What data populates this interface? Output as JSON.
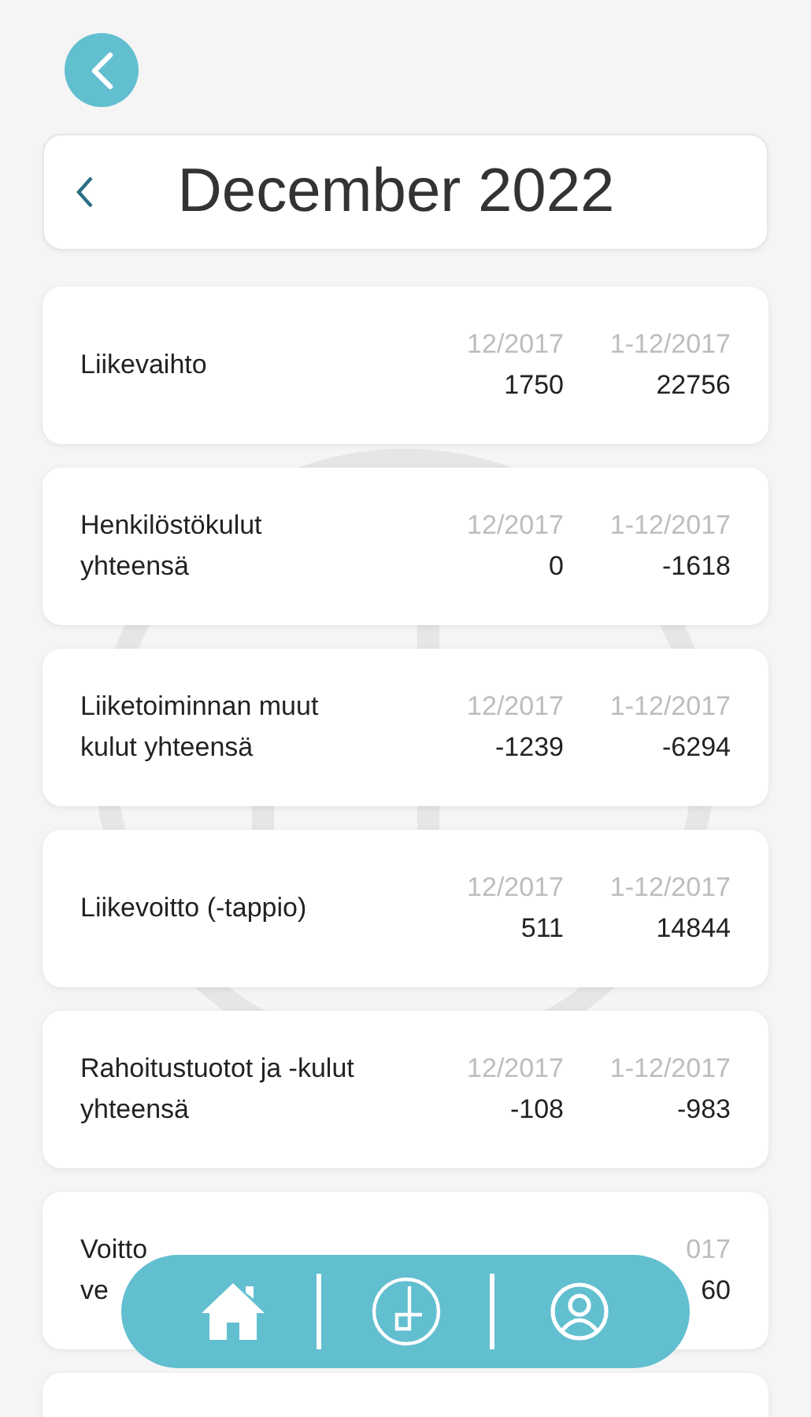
{
  "header": {
    "title": "December 2022"
  },
  "rows": [
    {
      "label": "Liikevaihto",
      "columns": [
        {
          "period": "12/2017",
          "value": "1750"
        },
        {
          "period": "1-12/2017",
          "value": "22756"
        }
      ]
    },
    {
      "label": "Henkilöstökulut yhteensä",
      "columns": [
        {
          "period": "12/2017",
          "value": "0"
        },
        {
          "period": "1-12/2017",
          "value": "-1618"
        }
      ]
    },
    {
      "label": "Liiketoiminnan muut kulut yhteensä",
      "columns": [
        {
          "period": "12/2017",
          "value": "-1239"
        },
        {
          "period": "1-12/2017",
          "value": "-6294"
        }
      ]
    },
    {
      "label": "Liikevoitto (-tappio)",
      "columns": [
        {
          "period": "12/2017",
          "value": "511"
        },
        {
          "period": "1-12/2017",
          "value": "14844"
        }
      ]
    },
    {
      "label": "Rahoitustuotot ja -kulut yhteensä",
      "columns": [
        {
          "period": "12/2017",
          "value": "-108"
        },
        {
          "period": "1-12/2017",
          "value": "-983"
        }
      ]
    },
    {
      "label_lines": [
        "Voitto",
        "ve"
      ],
      "columns": [
        {},
        {
          "period": "017",
          "value": "60"
        }
      ]
    }
  ],
  "bottom_nav": [
    {
      "kind": "home"
    },
    {
      "kind": "logo"
    },
    {
      "kind": "profile"
    }
  ]
}
